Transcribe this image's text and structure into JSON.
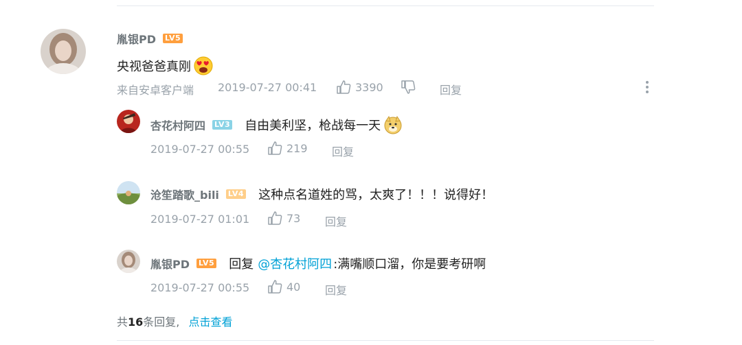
{
  "main_comment": {
    "username": "胤银PD",
    "level": "LV5",
    "text": "央视爸爸真刚",
    "emoji": "heart-eyes-emoji",
    "source": "来自安卓客户端",
    "time": "2019-07-27 00:41",
    "likes": "3390",
    "reply_label": "回复"
  },
  "replies": [
    {
      "username": "杏花村阿四",
      "level": "LV3",
      "text": "自由美利坚，枪战每一天",
      "emoji": "doge-emoji",
      "time": "2019-07-27 00:55",
      "likes": "219",
      "reply_label": "回复"
    },
    {
      "username": "沧笙踏歌_bili",
      "level": "LV4",
      "text": "这种点名道姓的骂，太爽了！！！说得好！",
      "time": "2019-07-27 01:01",
      "likes": "73",
      "reply_label": "回复"
    },
    {
      "username": "胤银PD",
      "level": "LV5",
      "reply_prefix": "回复",
      "mention": "@杏花村阿四",
      "text": ":满嘴顺口溜，你是要考研啊",
      "time": "2019-07-27 00:55",
      "likes": "40",
      "reply_label": "回复"
    }
  ],
  "footer": {
    "prefix": "共",
    "count": "16",
    "suffix": "条回复,",
    "view_link": "点击查看"
  },
  "colors": {
    "accent": "#00a1d6",
    "lv5": "#ff9f3e",
    "lv3": "#8ad3e6",
    "lv4": "#ffcf8a",
    "meta": "#99a2aa"
  }
}
